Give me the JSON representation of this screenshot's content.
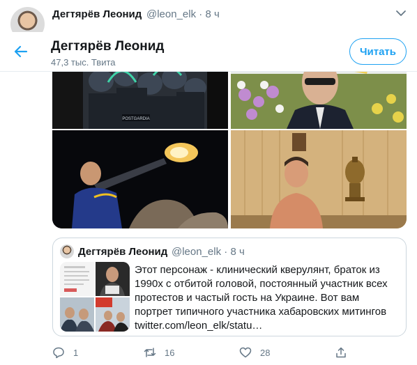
{
  "tweet": {
    "author_name": "Дегтярёв Леонид",
    "author_handle": "@leon_elk",
    "time": "· 8 ч"
  },
  "profile_bar": {
    "title": "Дегтярёв Леонид",
    "subtitle": "47,3 тыс. Твита",
    "follow_label": "Читать"
  },
  "photo_caption": "POSTGARDIA",
  "quoted": {
    "author_name": "Дегтярёв Леонид",
    "author_handle": "@leon_elk",
    "time": "· 8 ч",
    "text_lines": [
      "Этот персонаж - клинический кверулянт, браток из",
      "1990х с отбитой головой, постоянный участник всех",
      "протестов и частый гость на Украине. Вот вам",
      "портрет типичного участника хабаровских митингов",
      "twitter.com/leon_elk/statu…"
    ]
  },
  "actions": {
    "reply_count": "1",
    "retweet_count": "16",
    "like_count": "28"
  },
  "colors": {
    "accent": "#1da1f2",
    "secondary_text": "#657786",
    "border": "#ccd6dd"
  }
}
